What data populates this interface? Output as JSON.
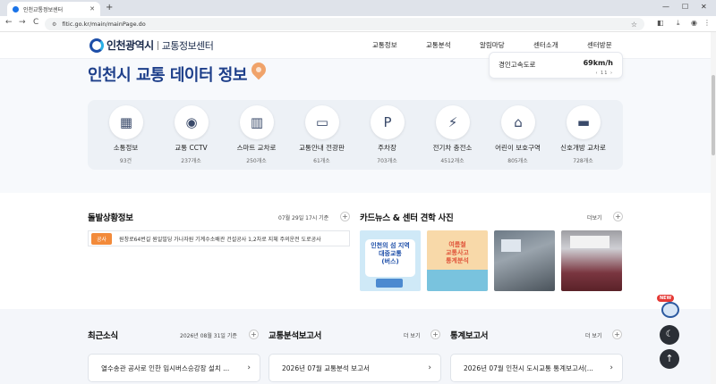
{
  "browser": {
    "tab_title": "인천교통정보센터",
    "url": "fitic.go.kr/main/mainPage.do",
    "new_tab": "+",
    "controls": {
      "back": "←",
      "forward": "→",
      "reload": "C"
    }
  },
  "header": {
    "logo_city": "인천광역시",
    "logo_center": "교통정보센터",
    "nav": [
      "교통정보",
      "교통분석",
      "알림마당",
      "센터소개",
      "센터방문"
    ]
  },
  "hero": {
    "title": "인천시 교통 데이터 정보",
    "speed": {
      "road": "경인고속도로",
      "value": "69km/h",
      "pager": "‹ 11 ›"
    },
    "stats": [
      {
        "label": "소통정보",
        "count": "93건",
        "icon": "road-icon",
        "glyph": "▦"
      },
      {
        "label": "교통 CCTV",
        "count": "237개소",
        "icon": "cctv-icon",
        "glyph": "◉"
      },
      {
        "label": "스마트 교차로",
        "count": "250개소",
        "icon": "smart-intersection-icon",
        "glyph": "▥"
      },
      {
        "label": "교통안내 전광판",
        "count": "61개소",
        "icon": "sign-board-icon",
        "glyph": "▭"
      },
      {
        "label": "주차장",
        "count": "703개소",
        "icon": "parking-icon",
        "glyph": "P"
      },
      {
        "label": "전기차 충전소",
        "count": "4512개소",
        "icon": "ev-charger-icon",
        "glyph": "⚡"
      },
      {
        "label": "어린이 보호구역",
        "count": "805개소",
        "icon": "school-zone-icon",
        "glyph": "⌂"
      },
      {
        "label": "신호개방 교차로",
        "count": "728개소",
        "icon": "signal-icon",
        "glyph": "▬"
      }
    ]
  },
  "emergency": {
    "title": "돌발상황정보",
    "date": "07월 29일 17시 기준",
    "badge": "공사",
    "text": "원창로64번길 원일빌딩 가나자원 기계수소배관 건설공사 1,2차로 지체 주의운전 도로공사"
  },
  "cardnews": {
    "title": "카드뉴스 & 센터 견학 사진",
    "more": "더보기",
    "thumb1_lines": [
      "인천의 섬 지역",
      "대중교통",
      "(버스)"
    ],
    "thumb2_lines": [
      "여름철",
      "교통사고",
      "통계분석"
    ]
  },
  "news": {
    "title": "최근소식",
    "date": "2026년 08월 31일 기준",
    "item": "열수송관 공사로 인한 임시버스승강장 설치 ..."
  },
  "analysis": {
    "title": "교통분석보고서",
    "more": "더 보기",
    "item": "2026년 07월 교통분석 보고서"
  },
  "stats_report": {
    "title": "통계보고서",
    "more": "더 보기",
    "item": "2026년 07월 인천시 도시교통 통계보고서(..."
  },
  "floating": {
    "new_badge": "NEW",
    "dark_glyph": "☾",
    "top_glyph": "↑"
  }
}
